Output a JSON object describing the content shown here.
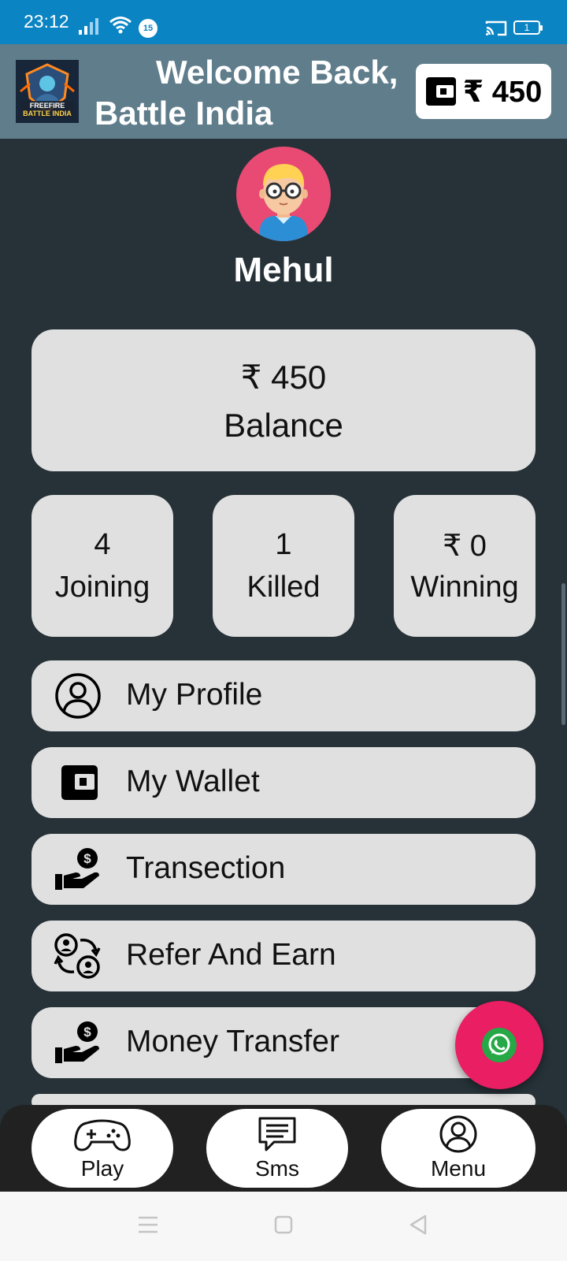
{
  "status": {
    "time": "23:12",
    "notification_count": "15",
    "battery": "1"
  },
  "header": {
    "welcome_line1": "Welcome Back,",
    "welcome_line2": "Battle India",
    "wallet_amount": "₹ 450",
    "logo_text_line1": "FREEFIRE",
    "logo_text_line2": "BATTLE INDIA"
  },
  "profile": {
    "name": "Mehul"
  },
  "balance": {
    "amount": "₹ 450",
    "label": "Balance"
  },
  "stats": [
    {
      "value": "4",
      "label": "Joining"
    },
    {
      "value": "1",
      "label": "Killed"
    },
    {
      "value": "₹ 0",
      "label": "Winning"
    }
  ],
  "menu": [
    {
      "label": "My Profile",
      "icon": "user-circle-icon"
    },
    {
      "label": "My Wallet",
      "icon": "wallet-icon"
    },
    {
      "label": "Transection",
      "icon": "hand-dollar-icon"
    },
    {
      "label": "Refer And Earn",
      "icon": "refer-users-icon"
    },
    {
      "label": "Money Transfer",
      "icon": "hand-dollar-icon"
    }
  ],
  "bottom_nav": [
    {
      "label": "Play",
      "icon": "gamepad-icon"
    },
    {
      "label": "Sms",
      "icon": "chat-icon"
    },
    {
      "label": "Menu",
      "icon": "user-circle-icon"
    }
  ],
  "colors": {
    "status_bar": "#0b84c4",
    "header": "#607d8b",
    "background": "#263238",
    "card": "#e0e0e0",
    "fab": "#e91e63",
    "whatsapp": "#25a845"
  }
}
